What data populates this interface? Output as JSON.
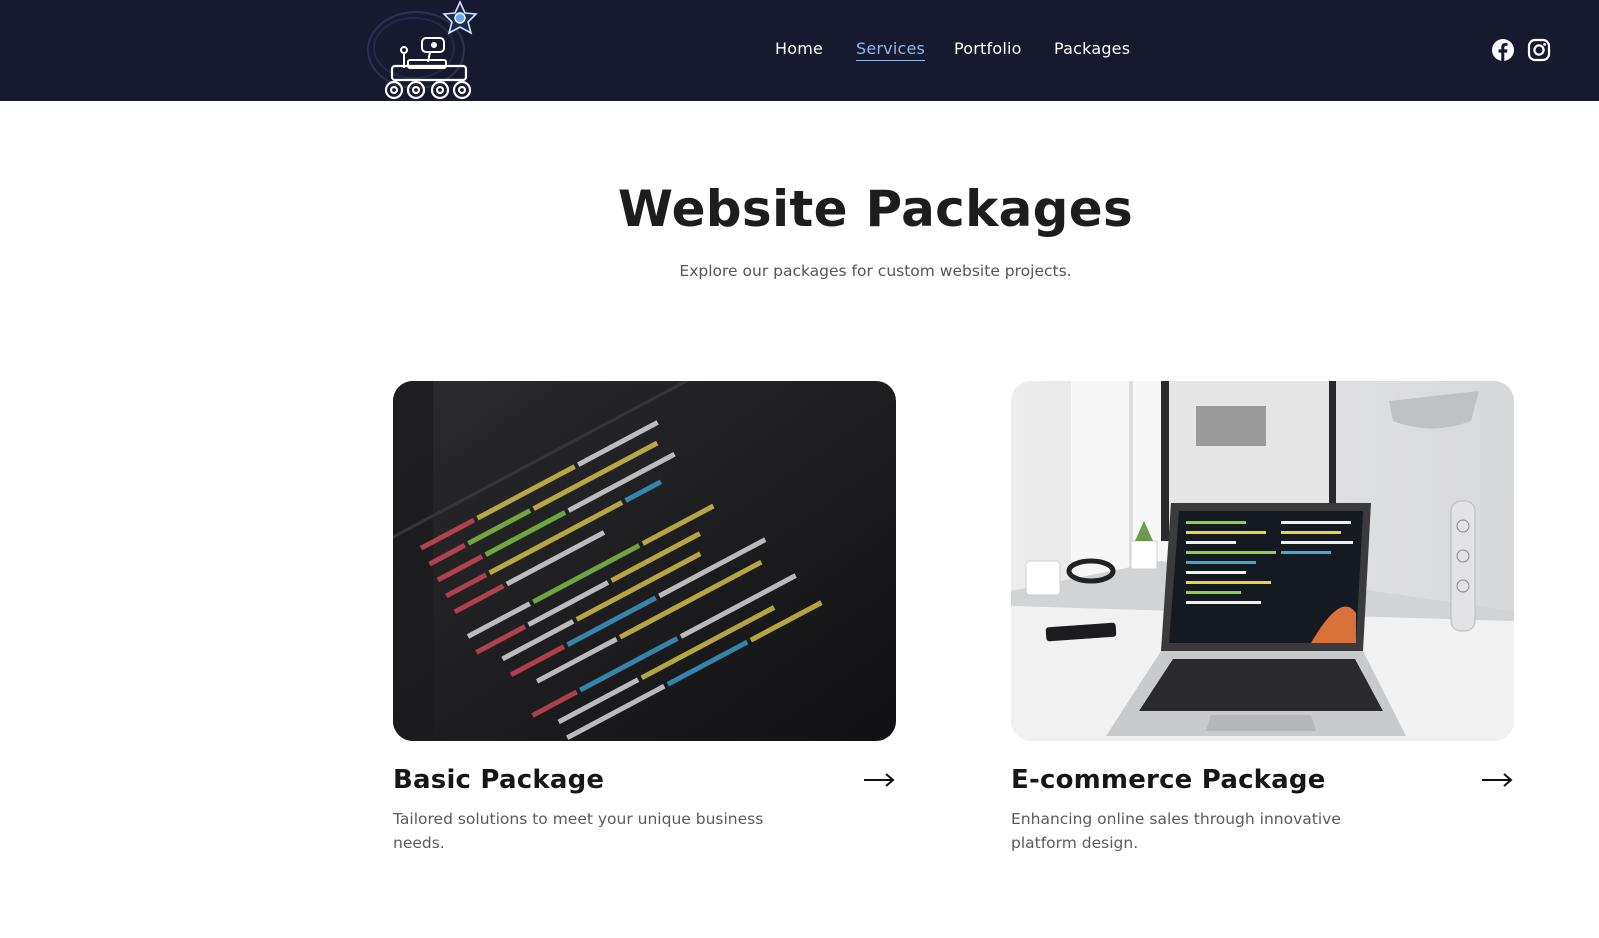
{
  "nav": {
    "items": [
      {
        "label": "Home"
      },
      {
        "label": "Services",
        "active": true
      },
      {
        "label": "Portfolio"
      },
      {
        "label": "Packages"
      }
    ]
  },
  "social": {
    "icons": [
      "facebook-icon",
      "instagram-icon"
    ]
  },
  "hero": {
    "title": "Website Packages",
    "subtitle": "Explore our packages for custom website projects."
  },
  "cards": [
    {
      "title": "Basic Package",
      "description": "Tailored solutions to meet your unique business needs.",
      "image": "code-on-screen-photo"
    },
    {
      "title": "E-commerce Package",
      "description": "Enhancing online sales through innovative platform design.",
      "image": "laptop-on-desk-photo"
    }
  ],
  "colors": {
    "header_bg": "#171a2e",
    "nav_active": "#8fb8ec",
    "title": "#1d1d1f",
    "text_muted": "#5b5b5b"
  }
}
